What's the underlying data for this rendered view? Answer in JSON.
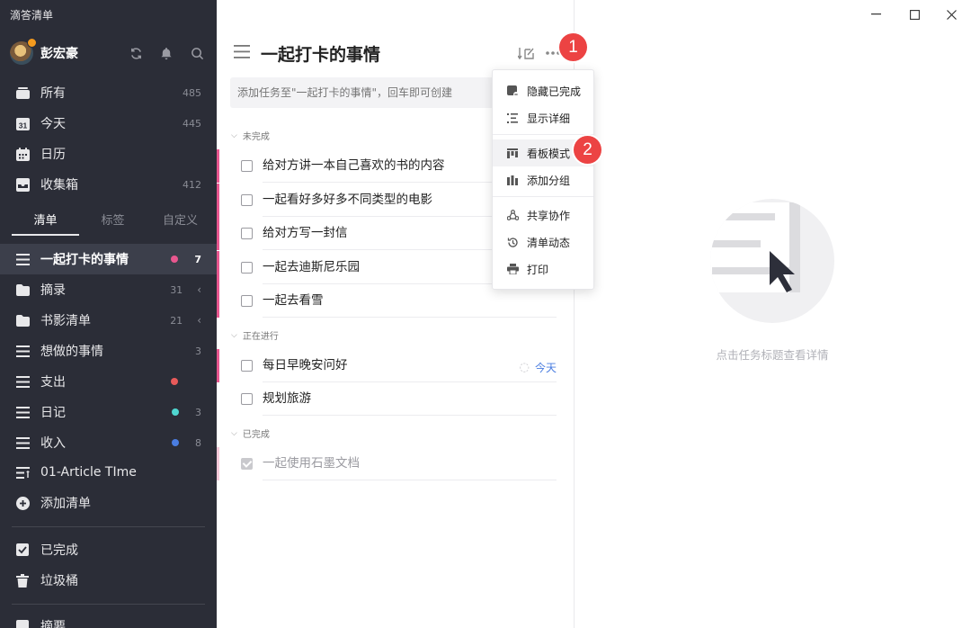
{
  "app": {
    "title": "滴答清单"
  },
  "user": {
    "name": "彭宏豪"
  },
  "smart_lists": [
    {
      "label": "所有",
      "count": "485"
    },
    {
      "label": "今天",
      "count": "445",
      "date": "31"
    },
    {
      "label": "日历",
      "count": ""
    },
    {
      "label": "收集箱",
      "count": "412"
    }
  ],
  "sidebar_tabs": [
    {
      "label": "清单",
      "active": true
    },
    {
      "label": "标签",
      "active": false
    },
    {
      "label": "自定义",
      "active": false
    }
  ],
  "lists": [
    {
      "label": "一起打卡的事情",
      "count": "7",
      "color": "#e8578f",
      "active": true
    },
    {
      "label": "摘录",
      "count": "31",
      "folder": true
    },
    {
      "label": "书影清单",
      "count": "21",
      "folder": true
    },
    {
      "label": "想做的事情",
      "count": "3"
    },
    {
      "label": "支出",
      "count": "",
      "color": "#e85a5a"
    },
    {
      "label": "日记",
      "count": "3",
      "color": "#4fd6d0"
    },
    {
      "label": "收入",
      "count": "8",
      "color": "#4a7de0"
    },
    {
      "label": "01-Article TIme",
      "count": ""
    },
    {
      "label": "添加清单",
      "count": ""
    }
  ],
  "bottom_lists": [
    {
      "label": "已完成"
    },
    {
      "label": "垃圾桶"
    },
    {
      "label": "摘要"
    }
  ],
  "task_panel": {
    "title": "一起打卡的事情",
    "add_placeholder": "添加任务至\"一起打卡的事情\"，回车即可创建",
    "sections": [
      {
        "label": "未完成",
        "tasks": [
          "给对方讲一本自己喜欢的书的内容",
          "一起看好多好多不同类型的电影",
          "给对方写一封信",
          "一起去迪斯尼乐园",
          "一起去看雪"
        ]
      },
      {
        "label": "正在进行",
        "tasks": [
          "每日早晚安问好",
          "规划旅游"
        ],
        "due": "今天"
      },
      {
        "label": "已完成",
        "tasks": [
          "一起使用石墨文档"
        ]
      }
    ]
  },
  "more_menu": {
    "items": [
      "隐藏已完成",
      "显示详细",
      "看板模式",
      "添加分组",
      "共享协作",
      "清单动态",
      "打印"
    ],
    "highlighted": "看板模式"
  },
  "callouts": [
    "1",
    "2"
  ],
  "detail": {
    "empty_text": "点击任务标题查看详情"
  },
  "colors": {
    "sidebar_bg": "#2b2d37",
    "accent_pink": "#e8578f",
    "callout_red": "#ec4343",
    "link_blue": "#4a7de0"
  }
}
